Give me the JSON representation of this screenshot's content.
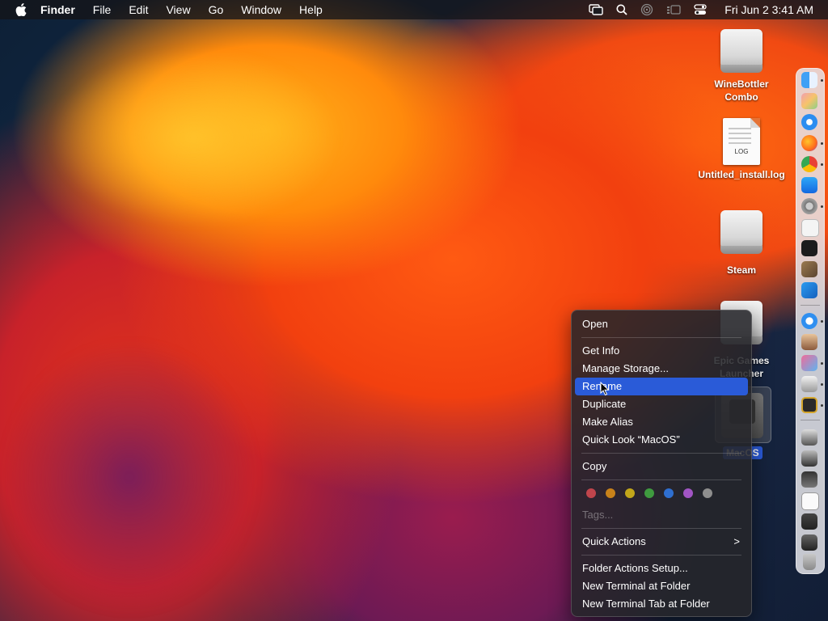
{
  "menubar": {
    "app_name": "Finder",
    "menus": [
      "File",
      "Edit",
      "View",
      "Go",
      "Window",
      "Help"
    ],
    "clock": "Fri Jun 2  3:41 AM",
    "status_icons": [
      "screen-mirroring-icon",
      "search-icon",
      "airdrop-icon",
      "stage-manager-icon",
      "control-center-icon"
    ]
  },
  "desktop": {
    "icons": [
      {
        "label": "WineBottler Combo",
        "kind": "drive"
      },
      {
        "label": "Untitled_install.log",
        "kind": "log-file",
        "badge": "LOG"
      },
      {
        "label": "Steam",
        "kind": "drive"
      },
      {
        "label": "Epic Games Launcher",
        "kind": "drive"
      },
      {
        "label": "MacOS",
        "kind": "drive",
        "selected": true
      }
    ]
  },
  "context_menu": {
    "open": "Open",
    "get_info": "Get Info",
    "manage_storage": "Manage Storage...",
    "rename": "Rename",
    "duplicate": "Duplicate",
    "make_alias": "Make Alias",
    "quick_look": "Quick Look “MacOS”",
    "copy": "Copy",
    "tags": "Tags...",
    "quick_actions": "Quick Actions",
    "quick_actions_arrow": ">",
    "folder_actions_setup": "Folder Actions Setup...",
    "new_terminal": "New Terminal at Folder",
    "new_terminal_tab": "New Terminal Tab at Folder",
    "tag_colors": [
      "#c0454c",
      "#c8821a",
      "#c2a61a",
      "#3f9a3f",
      "#2f6fd0",
      "#a155c4",
      "#8e8e8e"
    ]
  },
  "dock": {
    "apps": [
      "finder-icon",
      "launchpad-icon",
      "safari-icon",
      "firefox-icon",
      "chrome-icon",
      "app-store-icon",
      "system-settings-icon",
      "textedit-icon",
      "terminal-icon",
      "script-editor-icon",
      "vscode-icon",
      "app-icon",
      "wine-icon",
      "grapher-icon",
      "disk-utility-icon",
      "console-icon"
    ],
    "minimized": [
      "window-thumb-1",
      "window-thumb-2",
      "window-thumb-3",
      "window-thumb-4",
      "window-thumb-5",
      "window-thumb-6"
    ],
    "trash": "trash-icon"
  }
}
